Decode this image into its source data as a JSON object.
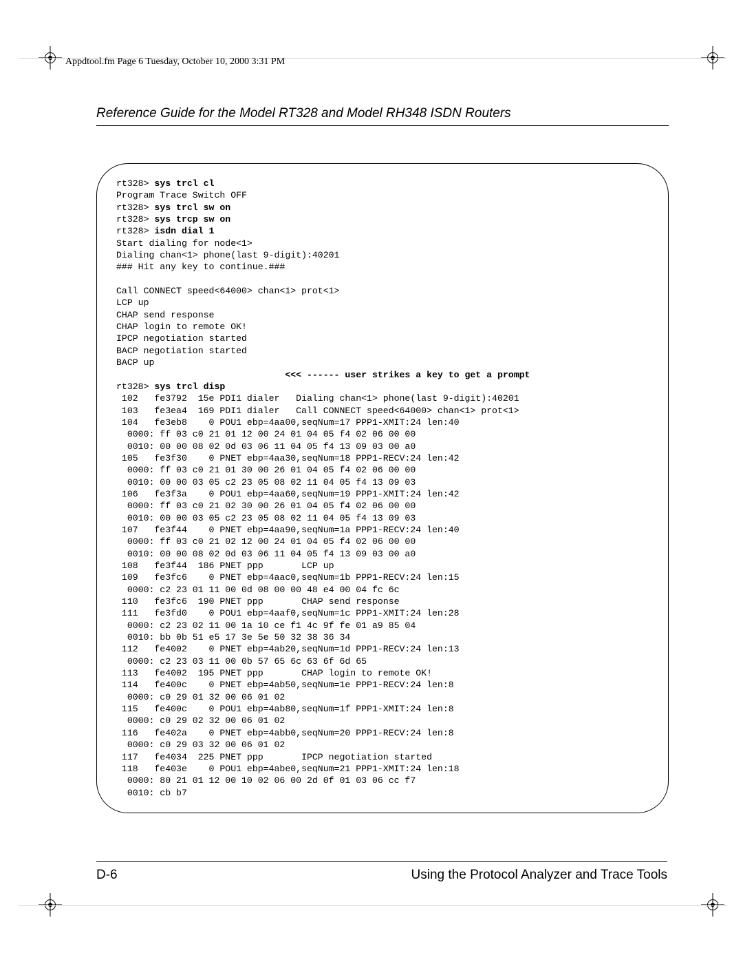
{
  "print_header": "Appdtool.fm  Page 6  Tuesday, October 10, 2000  3:31 PM",
  "document_title": "Reference Guide for the Model RT328 and Model RH348 ISDN Routers",
  "footer": {
    "left": "D-6",
    "right": "Using the Protocol Analyzer and Trace Tools"
  },
  "code": {
    "prefix": "rt328> ",
    "cmd1": "sys trcl cl",
    "line2": "Program Trace Switch OFF",
    "cmd2": "sys trcl sw on",
    "cmd3": "sys trcp sw on",
    "cmd4": "isdn dial 1",
    "line6": "Start dialing for node<1>",
    "line7": "Dialing chan<1> phone(last 9-digit):40201",
    "line8": "### Hit any key to continue.###",
    "line9": "",
    "line10": "Call CONNECT speed<64000> chan<1> prot<1>",
    "line11": "LCP up",
    "line12": "CHAP send response",
    "line13": "CHAP login to remote OK!",
    "line14": "IPCP negotiation started",
    "line15": "BACP negotiation started",
    "line16": "BACP up",
    "prompt_note_prefix": "                               ",
    "prompt_note": "<<< ------ user strikes a key to get a prompt",
    "cmd5": "sys trcl disp",
    "trace": [
      " 102   fe3792  15e PDI1 dialer   Dialing chan<1> phone(last 9-digit):40201",
      " 103   fe3ea4  169 PDI1 dialer   Call CONNECT speed<64000> chan<1> prot<1>",
      " 104   fe3eb8    0 POU1 ebp=4aa00,seqNum=17 PPP1-XMIT:24 len:40",
      "  0000: ff 03 c0 21 01 12 00 24 01 04 05 f4 02 06 00 00",
      "  0010: 00 00 08 02 0d 03 06 11 04 05 f4 13 09 03 00 a0",
      " 105   fe3f30    0 PNET ebp=4aa30,seqNum=18 PPP1-RECV:24 len:42",
      "  0000: ff 03 c0 21 01 30 00 26 01 04 05 f4 02 06 00 00",
      "  0010: 00 00 03 05 c2 23 05 08 02 11 04 05 f4 13 09 03",
      " 106   fe3f3a    0 POU1 ebp=4aa60,seqNum=19 PPP1-XMIT:24 len:42",
      "  0000: ff 03 c0 21 02 30 00 26 01 04 05 f4 02 06 00 00",
      "  0010: 00 00 03 05 c2 23 05 08 02 11 04 05 f4 13 09 03",
      " 107   fe3f44    0 PNET ebp=4aa90,seqNum=1a PPP1-RECV:24 len:40",
      "  0000: ff 03 c0 21 02 12 00 24 01 04 05 f4 02 06 00 00",
      "  0010: 00 00 08 02 0d 03 06 11 04 05 f4 13 09 03 00 a0",
      " 108   fe3f44  186 PNET ppp       LCP up",
      " 109   fe3fc6    0 PNET ebp=4aac0,seqNum=1b PPP1-RECV:24 len:15",
      "  0000: c2 23 01 11 00 0d 08 00 00 48 e4 00 04 fc 6c",
      " 110   fe3fc6  190 PNET ppp       CHAP send response",
      " 111   fe3fd0    0 POU1 ebp=4aaf0,seqNum=1c PPP1-XMIT:24 len:28",
      "  0000: c2 23 02 11 00 1a 10 ce f1 4c 9f fe 01 a9 85 04",
      "  0010: bb 0b 51 e5 17 3e 5e 50 32 38 36 34",
      " 112   fe4002    0 PNET ebp=4ab20,seqNum=1d PPP1-RECV:24 len:13",
      "  0000: c2 23 03 11 00 0b 57 65 6c 63 6f 6d 65",
      " 113   fe4002  195 PNET ppp       CHAP login to remote OK!",
      " 114   fe400c    0 PNET ebp=4ab50,seqNum=1e PPP1-RECV:24 len:8",
      "  0000: c0 29 01 32 00 06 01 02",
      " 115   fe400c    0 POU1 ebp=4ab80,seqNum=1f PPP1-XMIT:24 len:8",
      "  0000: c0 29 02 32 00 06 01 02",
      " 116   fe402a    0 PNET ebp=4abb0,seqNum=20 PPP1-RECV:24 len:8",
      "  0000: c0 29 03 32 00 06 01 02",
      " 117   fe4034  225 PNET ppp       IPCP negotiation started",
      " 118   fe403e    0 POU1 ebp=4abe0,seqNum=21 PPP1-XMIT:24 len:18",
      "  0000: 80 21 01 12 00 10 02 06 00 2d 0f 01 03 06 cc f7",
      "  0010: cb b7"
    ]
  }
}
